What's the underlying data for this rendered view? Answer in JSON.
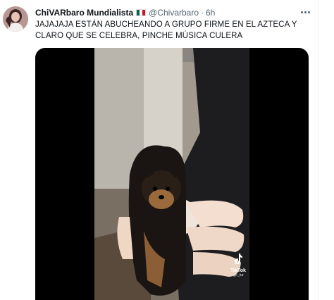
{
  "tweet": {
    "display_name": "ChiVARbaro Mundialista",
    "flag_icon": "mexico-flag-icon",
    "flag_colors": [
      "#006847",
      "#ffffff",
      "#ce1126"
    ],
    "handle": "@Chivarbaro",
    "separator": "·",
    "time": "6h",
    "text": "JAJAJAJA ESTÁN ABUCHEANDO A GRUPO FIRME EN EL AZTECA Y CLARO QUE SE CELEBRA, PINCHE MÚSICA CULERA",
    "more_icon": "more-options-icon",
    "media": {
      "watermark": "TikTok",
      "watermark_handle": "@r_tur",
      "watermark_icon": "tiktok-logo-icon"
    }
  },
  "colors": {
    "text_primary": "#0f1419",
    "text_secondary": "#536471",
    "media_background": "#000000"
  }
}
